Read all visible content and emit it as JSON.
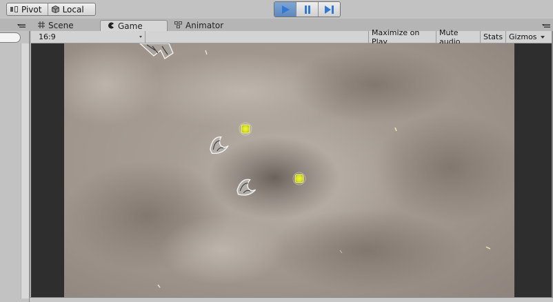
{
  "toolbar": {
    "pivot_label": "Pivot",
    "local_label": "Local",
    "play_icon": "play-icon",
    "pause_icon": "pause-icon",
    "step_icon": "step-icon",
    "accent_color": "#2f78d6"
  },
  "tabs": [
    {
      "label": "Scene",
      "icon": "scene-grid-icon",
      "active": false
    },
    {
      "label": "Game",
      "icon": "game-pacman-icon",
      "active": true
    },
    {
      "label": "Animator",
      "icon": "animator-icon",
      "active": false
    }
  ],
  "game_toolbar": {
    "aspect_value": "16:9",
    "maximize_label": "Maximize on Play",
    "mute_label": "Mute audio",
    "stats_label": "Stats",
    "gizmos_label": "Gizmos"
  },
  "colors": {
    "background_sky": "#a39990",
    "pickup_yellow": "#e7f029",
    "ship_outline": "#f2f2f2"
  }
}
